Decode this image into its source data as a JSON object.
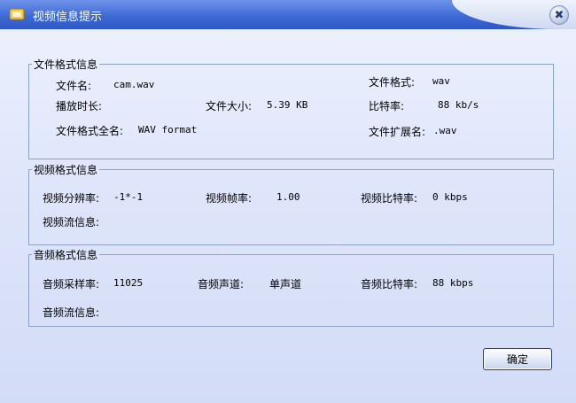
{
  "window": {
    "title": "视频信息提示",
    "close_glyph": "✖"
  },
  "file_info": {
    "legend": "文件格式信息",
    "file_name_label": "文件名:",
    "file_name": "cam.wav",
    "format_label": "文件格式:",
    "format": "wav",
    "duration_label": "播放时长:",
    "duration": "",
    "size_label": "文件大小:",
    "size": "5.39 KB",
    "bitrate_label": "比特率:",
    "bitrate": "88 kb/s",
    "full_name_label": "文件格式全名:",
    "full_name": "WAV format",
    "extension_label": "文件扩展名:",
    "extension": ".wav"
  },
  "video_info": {
    "legend": "视频格式信息",
    "resolution_label": "视频分辨率:",
    "resolution": "-1*-1",
    "framerate_label": "视频帧率:",
    "framerate": "1.00",
    "bitrate_label": "视频比特率:",
    "bitrate": "0  kbps",
    "stream_label": "视频流信息:",
    "stream": ""
  },
  "audio_info": {
    "legend": "音频格式信息",
    "samplerate_label": "音频采样率:",
    "samplerate": "11025",
    "channels_label": "音频声道:",
    "channels": "单声道",
    "bitrate_label": "音频比特率:",
    "bitrate": "88  kbps",
    "stream_label": "音频流信息:",
    "stream": ""
  },
  "footer": {
    "ok_label": "确定"
  }
}
